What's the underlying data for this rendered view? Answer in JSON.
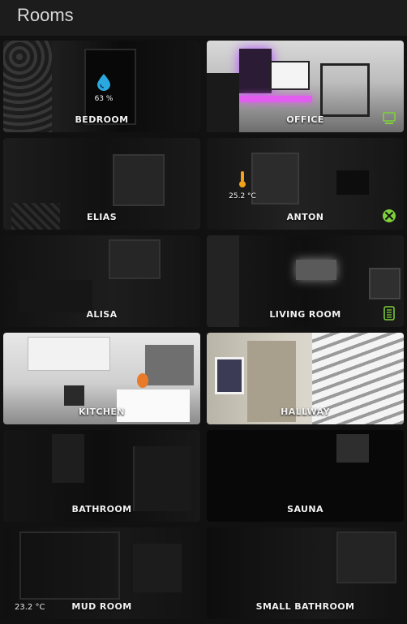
{
  "header": {
    "title": "Rooms"
  },
  "colors": {
    "accent_green": "#7fd13b",
    "drop_blue": "#2aa9e0",
    "thermo_orange": "#f2a31b"
  },
  "rooms": [
    {
      "name": "BEDROOM",
      "sensor": {
        "icon": "water-drop-icon",
        "value": "63 %"
      }
    },
    {
      "name": "OFFICE",
      "badge": "monitor-icon"
    },
    {
      "name": "ELIAS"
    },
    {
      "name": "ANTON",
      "sensor": {
        "icon": "thermometer-icon",
        "value": "25.2 °C"
      },
      "badge": "xbox-icon"
    },
    {
      "name": "ALISA"
    },
    {
      "name": "LIVING ROOM",
      "badge": "air-purifier-icon"
    },
    {
      "name": "KITCHEN"
    },
    {
      "name": "HALLWAY"
    },
    {
      "name": "BATHROOM"
    },
    {
      "name": "SAUNA"
    },
    {
      "name": "MUD ROOM",
      "corner_temp": "23.2 °C"
    },
    {
      "name": "SMALL BATHROOM"
    }
  ]
}
